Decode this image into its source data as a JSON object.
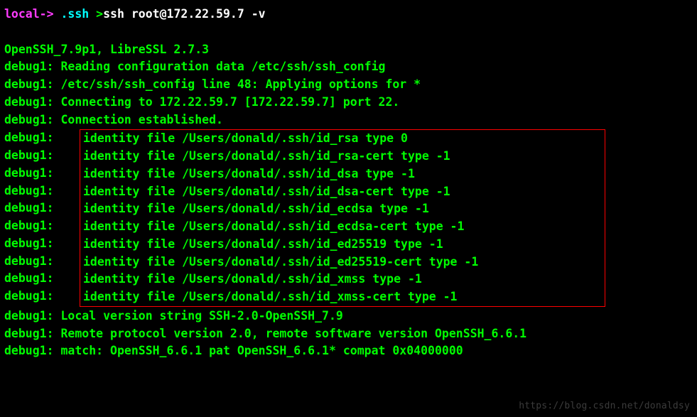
{
  "prompt": {
    "host": "local->",
    "path": ".ssh",
    "gt": ">",
    "command": "ssh root@172.22.59.7 -v"
  },
  "banner": "OpenSSH_7.9p1, LibreSSL 2.7.3",
  "pre_lines": [
    "Reading configuration data /etc/ssh/ssh_config",
    "/etc/ssh/ssh_config line 48: Applying options for *",
    "Connecting to 172.22.59.7 [172.22.59.7] port 22.",
    "Connection established."
  ],
  "boxed_lines": [
    "identity file /Users/donald/.ssh/id_rsa type 0",
    "identity file /Users/donald/.ssh/id_rsa-cert type -1",
    "identity file /Users/donald/.ssh/id_dsa type -1",
    "identity file /Users/donald/.ssh/id_dsa-cert type -1",
    "identity file /Users/donald/.ssh/id_ecdsa type -1",
    "identity file /Users/donald/.ssh/id_ecdsa-cert type -1",
    "identity file /Users/donald/.ssh/id_ed25519 type -1",
    "identity file /Users/donald/.ssh/id_ed25519-cert type -1",
    "identity file /Users/donald/.ssh/id_xmss type -1",
    "identity file /Users/donald/.ssh/id_xmss-cert type -1"
  ],
  "post_lines": [
    "Local version string SSH-2.0-OpenSSH_7.9",
    "Remote protocol version 2.0, remote software version OpenSSH_6.6.1",
    "match: OpenSSH_6.6.1 pat OpenSSH_6.6.1* compat 0x04000000"
  ],
  "debug_label": "debug1:",
  "watermark": "https://blog.csdn.net/donaldsy"
}
